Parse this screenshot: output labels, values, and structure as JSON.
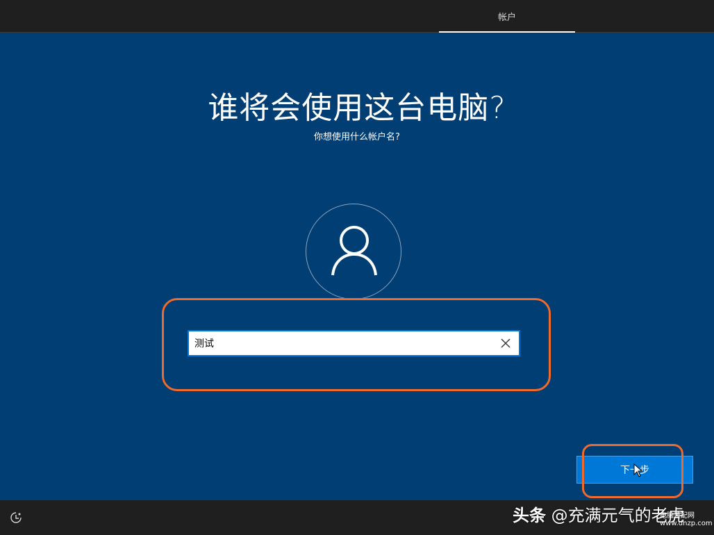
{
  "header": {
    "tab_account": "帐户"
  },
  "main": {
    "title": "谁将会使用这台电脑?",
    "subtitle": "你想使用什么帐户名?",
    "username_input": {
      "value": "测试"
    },
    "next_button": "下一步"
  },
  "footer": {
    "watermark_brand": "头条",
    "watermark_handle": "@充满元气的老虎",
    "site_name": "电脑装配网",
    "site_url": "www.dnzp.com"
  },
  "icons": {
    "avatar": "user-icon",
    "clear": "close-icon",
    "accessibility": "ease-of-access-icon"
  },
  "colors": {
    "panel_bg": "#003e73",
    "accent": "#0078d7",
    "highlight": "#f06a2b"
  }
}
